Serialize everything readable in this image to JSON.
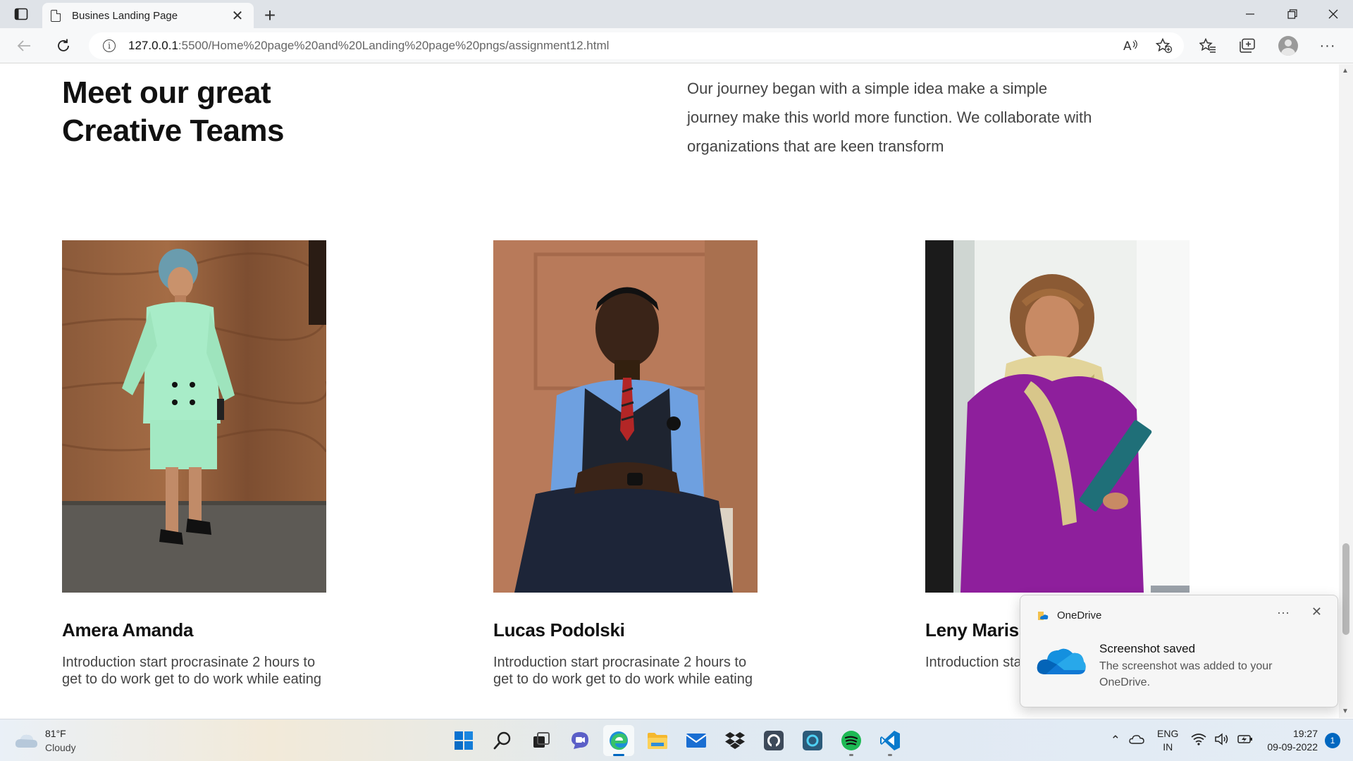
{
  "browser": {
    "tab_title": "Busines Landing Page",
    "url_host": "127.0.0.1",
    "url_path": ":5500/Home%20page%20and%20Landing%20page%20pngs/assignment12.html"
  },
  "page": {
    "heading_line1": "Meet our great",
    "heading_line2": "Creative Teams",
    "intro": "Our journey began with a simple idea make a simple journey make this world more function. We collaborate with organizations that are keen transform",
    "team": [
      {
        "name": "Amera Amanda",
        "bio": "Introduction start procrasinate 2 hours to get to do work get to do work while eating"
      },
      {
        "name": "Lucas Podolski",
        "bio": "Introduction start procrasinate 2 hours to get to do work get to do work while eating"
      },
      {
        "name": "Leny Mariss",
        "bio": "Introduction sta get to do work"
      }
    ]
  },
  "toast": {
    "app": "OneDrive",
    "more": "···",
    "title": "Screenshot saved",
    "body": "The screenshot was added to your OneDrive."
  },
  "taskbar": {
    "weather_temp": "81°F",
    "weather_desc": "Cloudy",
    "lang_line1": "ENG",
    "lang_line2": "IN",
    "time": "19:27",
    "date": "09-09-2022",
    "notifications": "1",
    "apps": [
      "start-icon",
      "search-icon",
      "task-view-icon",
      "teams-chat-icon",
      "edge-icon",
      "file-explorer-icon",
      "mail-icon",
      "dropbox-icon",
      "github-icon",
      "cortana-icon",
      "spotify-icon",
      "vscode-icon"
    ]
  },
  "colors": {
    "accent": "#0067c0",
    "onedrive_blue": "#0f78d4",
    "spotify_green": "#1db954",
    "vscode_blue": "#0a7acc"
  }
}
